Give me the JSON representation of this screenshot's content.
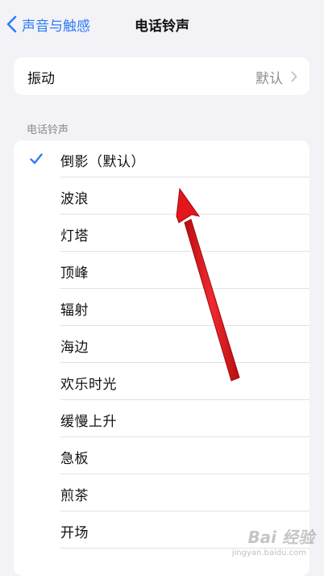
{
  "nav": {
    "back_label": "声音与触感",
    "title": "电话铃声",
    "back_icon": "chevron-left-icon"
  },
  "vibration": {
    "label": "振动",
    "value": "默认",
    "chevron_icon": "chevron-right-icon"
  },
  "ringtones": {
    "section_header": "电话铃声",
    "items": [
      {
        "label": "倒影（默认）",
        "selected": true
      },
      {
        "label": "波浪",
        "selected": false
      },
      {
        "label": "灯塔",
        "selected": false
      },
      {
        "label": "顶峰",
        "selected": false
      },
      {
        "label": "辐射",
        "selected": false
      },
      {
        "label": "海边",
        "selected": false
      },
      {
        "label": "欢乐时光",
        "selected": false
      },
      {
        "label": "缓慢上升",
        "selected": false
      },
      {
        "label": "急板",
        "selected": false
      },
      {
        "label": "煎茶",
        "selected": false
      },
      {
        "label": "开场",
        "selected": false
      }
    ]
  },
  "overlay": {
    "arrow_color": "#d9141a",
    "watermark_text": "Bai 经验",
    "watermark_sub": "jingyan.baidu.com"
  },
  "colors": {
    "accent": "#2f7cf6",
    "background": "#f2f2f7",
    "card": "#ffffff",
    "secondary_text": "#8e8e93"
  }
}
